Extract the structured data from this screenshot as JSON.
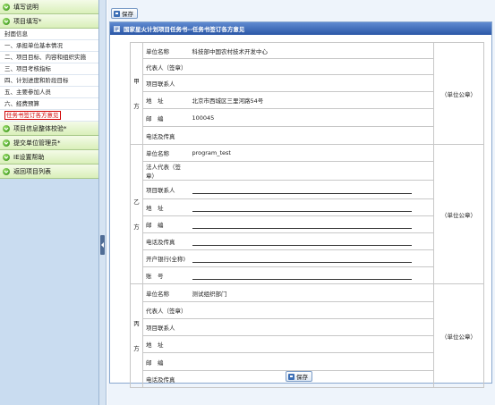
{
  "sidebar": {
    "groups": [
      {
        "label": "填写说明",
        "items": []
      },
      {
        "label": "项目填写*",
        "items": [
          {
            "label": "封面信息",
            "active": false
          },
          {
            "label": "一、承担单位基本情况",
            "active": false
          },
          {
            "label": "二、项目目标、内容和组织实施",
            "active": false
          },
          {
            "label": "三、项目考核指标",
            "active": false
          },
          {
            "label": "四、计划进度和阶段目标",
            "active": false
          },
          {
            "label": "五、主要参加人员",
            "active": false
          },
          {
            "label": "六、经费预算",
            "active": false
          },
          {
            "label": "任务书签订各方意见",
            "active": true
          }
        ]
      },
      {
        "label": "项目信息整体校验*",
        "items": []
      },
      {
        "label": "提交单位管理员*",
        "items": []
      },
      {
        "label": "IE设置帮助",
        "items": []
      },
      {
        "label": "返回项目列表",
        "items": []
      }
    ]
  },
  "toolbar": {
    "save_label": "保存"
  },
  "panel": {
    "title": "国家星火计划项目任务书--任务书签订各方意见"
  },
  "form": {
    "seal_label": "（单位公章）",
    "party_a": {
      "name": [
        "甲",
        "方"
      ],
      "fields": [
        {
          "label": "单位名称",
          "value": "科技部中国农村技术开发中心"
        },
        {
          "label": "代表人（签章）",
          "value": ""
        },
        {
          "label": "项目联系人",
          "value": ""
        },
        {
          "label": "地　址",
          "value": "北京市西城区三里河路54号"
        },
        {
          "label": "邮　编",
          "value": "100045"
        },
        {
          "label": "电话及传真",
          "value": ""
        }
      ]
    },
    "party_b": {
      "name": [
        "乙",
        "方"
      ],
      "fields": [
        {
          "label": "单位名称",
          "value": "program_test"
        },
        {
          "label": "法人代表（签章）",
          "value": ""
        },
        {
          "label": "项目联系人",
          "value": ""
        },
        {
          "label": "地　址",
          "value": ""
        },
        {
          "label": "邮　编",
          "value": ""
        },
        {
          "label": "电话及传真",
          "value": ""
        },
        {
          "label": "开户银行(全称)",
          "value": ""
        },
        {
          "label": "账　号",
          "value": ""
        }
      ]
    },
    "party_c": {
      "name": [
        "丙",
        "方"
      ],
      "fields": [
        {
          "label": "单位名称",
          "value": "测试组织部门"
        },
        {
          "label": "代表人（签章）",
          "value": ""
        },
        {
          "label": "项目联系人",
          "value": ""
        },
        {
          "label": "地　址",
          "value": ""
        },
        {
          "label": "邮　编",
          "value": ""
        },
        {
          "label": "电话及传真",
          "value": ""
        }
      ]
    }
  }
}
